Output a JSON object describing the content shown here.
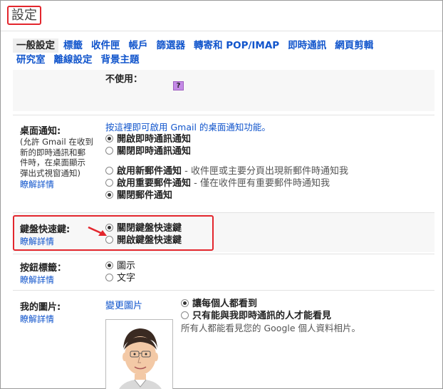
{
  "title": "設定",
  "tabs": [
    "一般設定",
    "標籤",
    "收件匣",
    "帳戶",
    "篩選器",
    "轉寄和 POP/IMAP",
    "即時通訊",
    "網頁剪輯",
    "研究室",
    "離線設定",
    "背景主題"
  ],
  "top_row": {
    "label": "不使用：",
    "swatch_text": "?"
  },
  "desktop": {
    "label": "桌面通知:",
    "sub": [
      "(允許 Gmail 在收到",
      "新的即時通訊和郵",
      "件時，在桌面顯示",
      "彈出式視窗通知)"
    ],
    "learn_more": "瞭解詳情",
    "link": "按這裡即可啟用 Gmail 的桌面通知功能。",
    "chat_options": [
      "開啟即時通訊通知",
      "關閉即時通訊通知"
    ],
    "mail_options": [
      {
        "label": "啟用新郵件通知",
        "desc": " - 收件匣或主要分頁出現新郵件時通知我"
      },
      {
        "label": "啟用重要郵件通知",
        "desc": " - 僅在收件匣有重要郵件時通知我"
      },
      {
        "label": "關閉郵件通知",
        "desc": ""
      }
    ]
  },
  "shortcuts": {
    "label": "鍵盤快速鍵:",
    "learn_more": "瞭解詳情",
    "options": [
      "關閉鍵盤快速鍵",
      "開啟鍵盤快速鍵"
    ]
  },
  "button_labels": {
    "label": "按鈕標籤：",
    "learn_more": "瞭解詳情",
    "options": [
      "圖示",
      "文字"
    ]
  },
  "picture": {
    "label": "我的圖片:",
    "learn_more": "瞭解詳情",
    "change": "變更圖片",
    "options": [
      "讓每個人都看到",
      "只有能與我即時通訊的人才能看見"
    ],
    "note": "所有人都能看見您的 Google 個人資料相片。"
  },
  "colors": {
    "accent": "#1155cc",
    "highlight": "#e3262d",
    "section_bg": "#f7f7f7"
  }
}
